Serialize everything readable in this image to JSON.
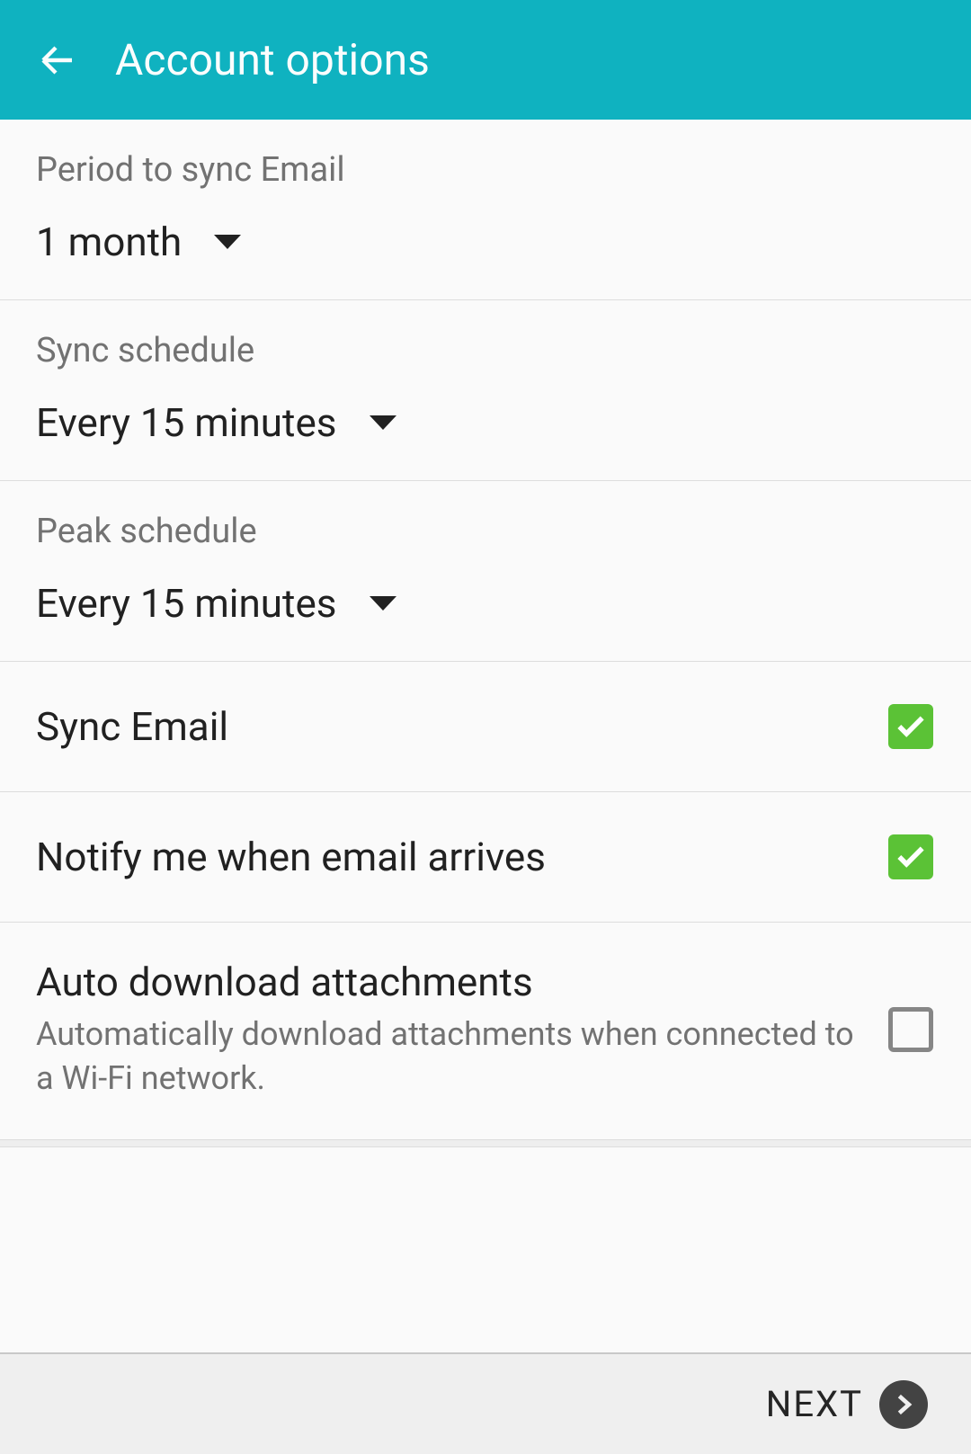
{
  "header": {
    "title": "Account options"
  },
  "settings": {
    "period_sync": {
      "label": "Period to sync Email",
      "value": "1 month"
    },
    "sync_schedule": {
      "label": "Sync schedule",
      "value": "Every 15 minutes"
    },
    "peak_schedule": {
      "label": "Peak schedule",
      "value": "Every 15 minutes"
    },
    "sync_email": {
      "label": "Sync Email",
      "checked": true
    },
    "notify": {
      "label": "Notify me when email arrives",
      "checked": true
    },
    "auto_download": {
      "label": "Auto download attachments",
      "sublabel": "Automatically download attachments when connected to a Wi-Fi network.",
      "checked": false
    }
  },
  "footer": {
    "next_label": "NEXT"
  },
  "colors": {
    "appbar": "#0fb2c0",
    "checked": "#5bc236"
  }
}
